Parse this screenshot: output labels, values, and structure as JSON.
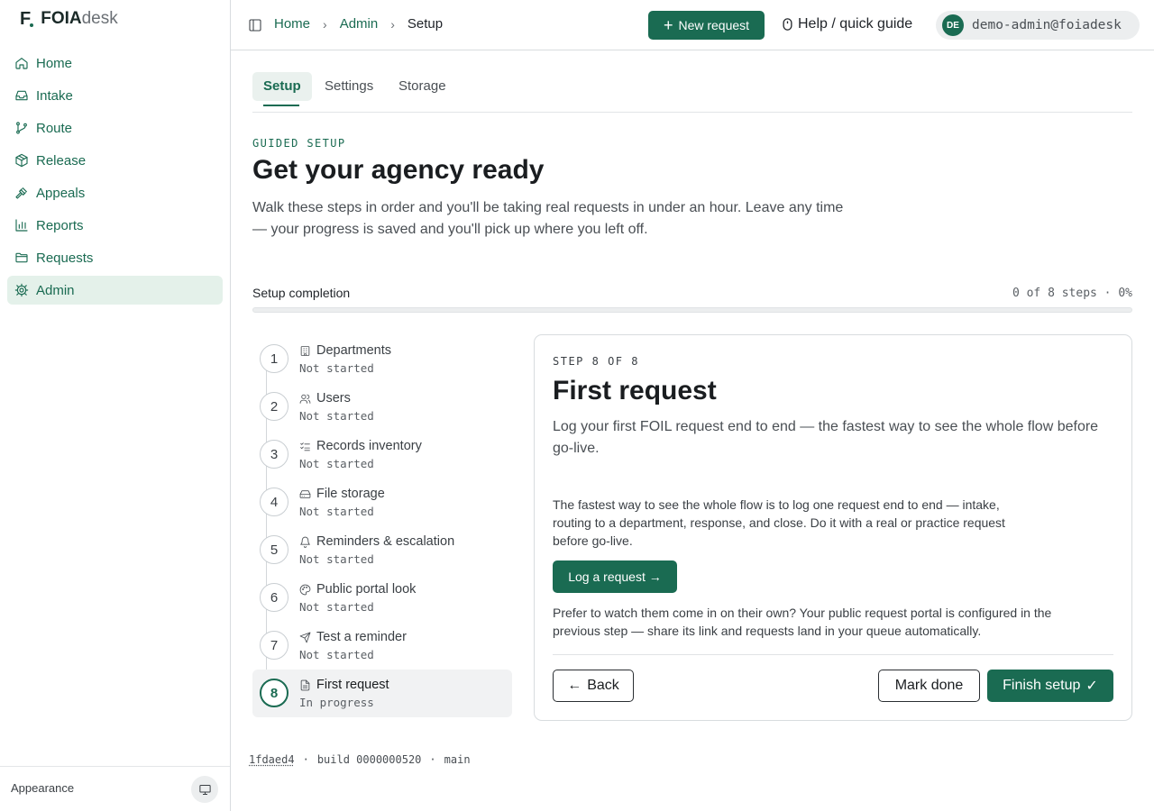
{
  "brand": {
    "mark": "F",
    "name_bold": "FOIA",
    "name_light": "desk",
    "accent": "#1a6b52"
  },
  "sidebar": {
    "items": [
      {
        "label": "Home",
        "icon": "home-icon",
        "active": false
      },
      {
        "label": "Intake",
        "icon": "inbox-icon",
        "active": false
      },
      {
        "label": "Route",
        "icon": "git-branch-icon",
        "active": false
      },
      {
        "label": "Release",
        "icon": "package-icon",
        "active": false
      },
      {
        "label": "Appeals",
        "icon": "gavel-icon",
        "active": false
      },
      {
        "label": "Reports",
        "icon": "bar-chart-icon",
        "active": false
      },
      {
        "label": "Requests",
        "icon": "folder-icon",
        "active": false
      },
      {
        "label": "Admin",
        "icon": "gear-icon",
        "active": true
      }
    ],
    "appearance_label": "Appearance"
  },
  "topbar": {
    "breadcrumbs": [
      "Home",
      "Admin",
      "Setup"
    ],
    "new_request_label": "New request",
    "help_label": "Help / quick guide",
    "user": {
      "initials": "DE",
      "email": "demo-admin@foiadesk"
    }
  },
  "tabs": [
    "Setup",
    "Settings",
    "Storage"
  ],
  "header": {
    "eyebrow": "GUIDED SETUP",
    "title": "Get your agency ready",
    "lead": "Walk these steps in order and you'll be taking real requests in under an hour. Leave any time — your progress is saved and you'll pick up where you left off."
  },
  "progress": {
    "label": "Setup completion",
    "count": "0 of 8 steps · 0%",
    "fraction": 0
  },
  "steps": [
    {
      "num": "1",
      "title": "Departments",
      "status": "Not started",
      "icon": "building-icon"
    },
    {
      "num": "2",
      "title": "Users",
      "status": "Not started",
      "icon": "users-icon"
    },
    {
      "num": "3",
      "title": "Records inventory",
      "status": "Not started",
      "icon": "list-checks-icon"
    },
    {
      "num": "4",
      "title": "File storage",
      "status": "Not started",
      "icon": "hard-drive-icon"
    },
    {
      "num": "5",
      "title": "Reminders & escalation",
      "status": "Not started",
      "icon": "bell-icon"
    },
    {
      "num": "6",
      "title": "Public portal look",
      "status": "Not started",
      "icon": "palette-icon"
    },
    {
      "num": "7",
      "title": "Test a reminder",
      "status": "Not started",
      "icon": "send-icon"
    },
    {
      "num": "8",
      "title": "First request",
      "status": "In progress",
      "icon": "file-text-icon",
      "current": true
    }
  ],
  "card": {
    "eyebrow": "STEP 8 OF 8",
    "title": "First request",
    "lead": "Log your first FOIL request end to end — the fastest way to see the whole flow before go-live.",
    "body1": "The fastest way to see the whole flow is to log one request end to end — intake, routing to a department, response, and close. Do it with a real or practice request before go-live.",
    "cta_label": "Log a request →",
    "body2": "Prefer to watch them come in on their own? Your public request portal is configured in the previous step — share its link and requests land in your queue automatically.",
    "back_label": "Back",
    "mark_done_label": "Mark done",
    "finish_label": "Finish setup"
  },
  "build": {
    "hash": "1fdaed4",
    "build": "build 0000000520",
    "branch": "main"
  }
}
